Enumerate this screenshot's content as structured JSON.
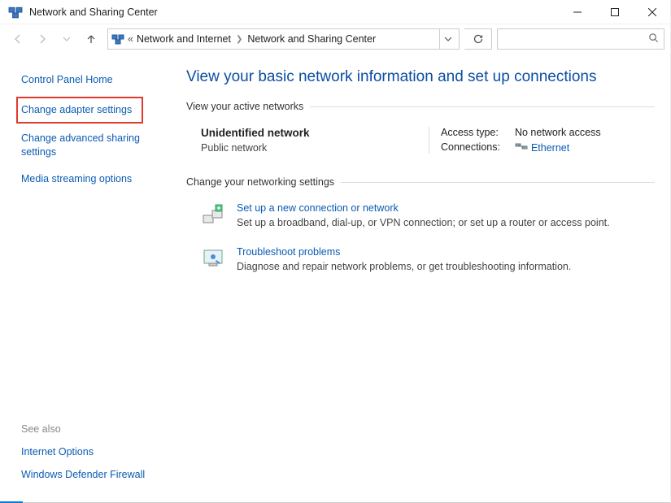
{
  "window": {
    "title": "Network and Sharing Center"
  },
  "breadcrumb": {
    "parent": "Network and Internet",
    "current": "Network and Sharing Center"
  },
  "sidebar": {
    "links": {
      "home": "Control Panel Home",
      "adapter": "Change adapter settings",
      "advanced": "Change advanced sharing settings",
      "media": "Media streaming options"
    },
    "see_also_title": "See also",
    "see_also": {
      "internet_options": "Internet Options",
      "firewall": "Windows Defender Firewall"
    }
  },
  "main": {
    "heading": "View your basic network information and set up connections",
    "active_label": "View your active networks",
    "network": {
      "name": "Unidentified network",
      "type": "Public network",
      "access_label": "Access type:",
      "access_value": "No network access",
      "conn_label": "Connections:",
      "conn_value": "Ethernet"
    },
    "change_label": "Change your networking settings",
    "setup": {
      "link": "Set up a new connection or network",
      "desc": "Set up a broadband, dial-up, or VPN connection; or set up a router or access point."
    },
    "troubleshoot": {
      "link": "Troubleshoot problems",
      "desc": "Diagnose and repair network problems, or get troubleshooting information."
    }
  }
}
